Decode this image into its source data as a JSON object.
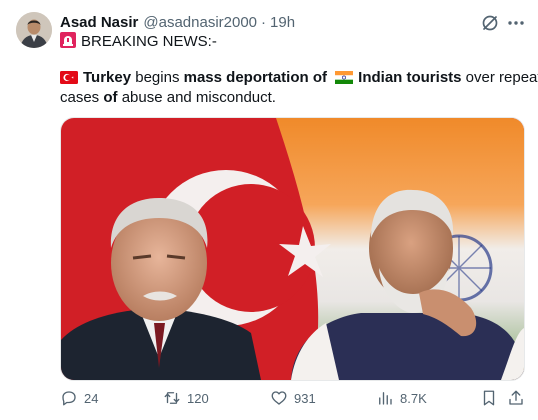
{
  "tweet": {
    "author_name": "Asad Nasir",
    "author_handle": "@asadnasir2000",
    "separator": "·",
    "timestamp": "19h",
    "line1_text": "BREAKING NEWS:-",
    "body": {
      "w1": "Turkey",
      "w2": " begins ",
      "w3": "mass deportation of",
      "w4": "Indian tourists",
      "w5": " over repeated",
      "line2_a": "cases ",
      "line2_b": "of",
      "line2_c": " abuse and misconduct."
    },
    "media_description_icon": "photo-turkey-india-leaders"
  },
  "actions": {
    "replies": "24",
    "reposts": "120",
    "likes": "931",
    "views": "8.7K"
  },
  "icons": {
    "header": [
      "grok-icon",
      "more-icon"
    ],
    "actions": [
      "reply-icon",
      "repost-icon",
      "like-icon",
      "views-icon",
      "bookmark-icon",
      "share-icon"
    ]
  },
  "colors": {
    "text_primary": "#0f1419",
    "text_secondary": "#536471",
    "turkey_red": "#e30a17",
    "india_saffron": "#ff9933",
    "india_green": "#138808"
  }
}
